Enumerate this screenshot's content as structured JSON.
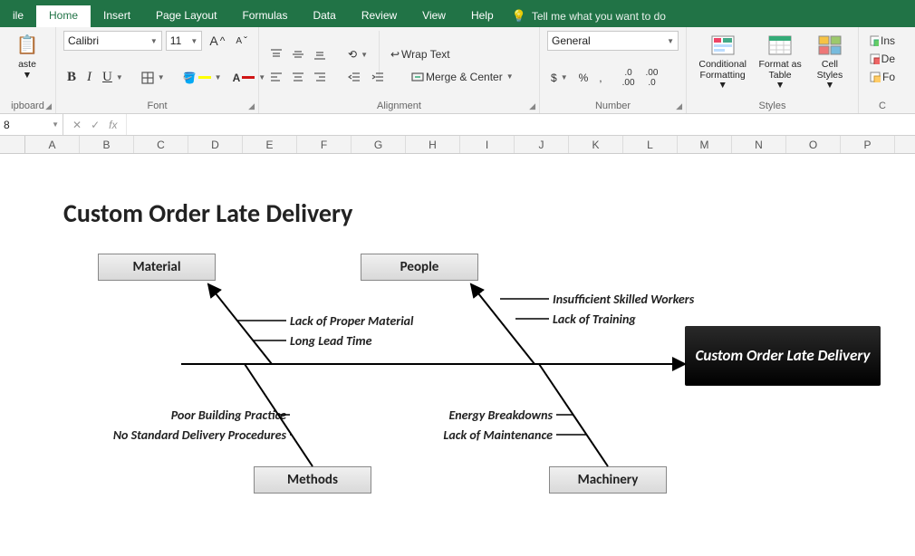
{
  "tabs": {
    "file": "ile",
    "home": "Home",
    "insert": "Insert",
    "page_layout": "Page Layout",
    "formulas": "Formulas",
    "data": "Data",
    "review": "Review",
    "view": "View",
    "help": "Help",
    "tell_me": "Tell me what you want to do"
  },
  "ribbon": {
    "clipboard": {
      "label": "ipboard",
      "paste": "aste"
    },
    "font": {
      "label": "Font",
      "name": "Calibri",
      "size": "11",
      "bold": "B",
      "italic": "I",
      "underline": "U"
    },
    "alignment": {
      "label": "Alignment",
      "wrap": "Wrap Text",
      "merge": "Merge & Center"
    },
    "number": {
      "label": "Number",
      "format": "General",
      "currency": "$",
      "percent": "%",
      "comma": ","
    },
    "styles": {
      "label": "Styles",
      "conditional": "Conditional Formatting",
      "table": "Format as Table",
      "cell": "Cell Styles"
    },
    "editing": {
      "ins": "Ins",
      "de": "De",
      "fo": "Fo"
    }
  },
  "fbar": {
    "name": "8",
    "fx": "fx"
  },
  "cols": [
    "A",
    "B",
    "C",
    "D",
    "E",
    "F",
    "G",
    "H",
    "I",
    "J",
    "K",
    "L",
    "M",
    "N",
    "O",
    "P"
  ],
  "diagram": {
    "title": "Custom Order Late Delivery",
    "effect": "Custom Order Late Delivery",
    "categories": {
      "material": "Material",
      "people": "People",
      "methods": "Methods",
      "machinery": "Machinery"
    },
    "causes": {
      "material": [
        "Lack of Proper Material",
        "Long Lead Time"
      ],
      "people": [
        "Insufficient Skilled Workers",
        "Lack of Training"
      ],
      "methods": [
        "Poor Building Practice",
        "No Standard Delivery Procedures"
      ],
      "machinery": [
        "Energy Breakdowns",
        "Lack of Maintenance"
      ]
    }
  }
}
